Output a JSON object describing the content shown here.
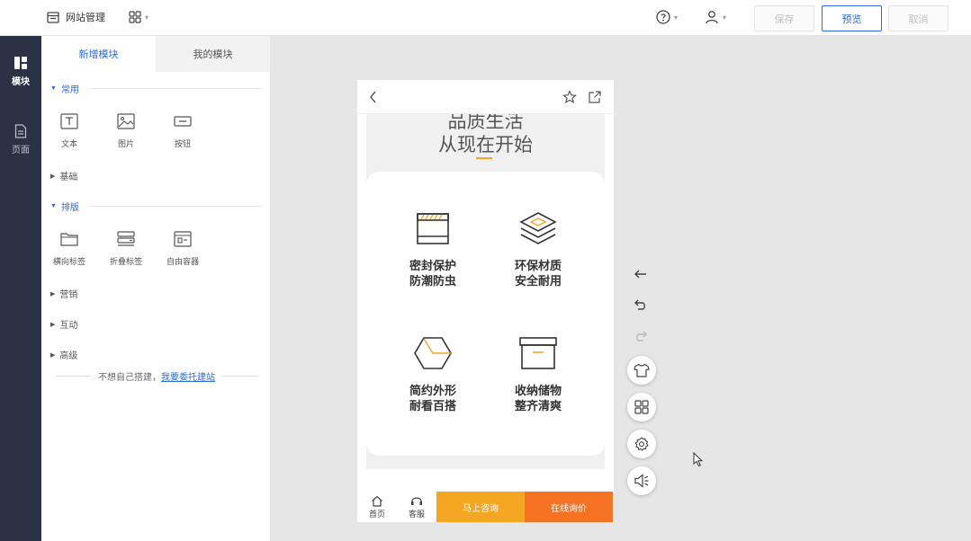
{
  "topbar": {
    "site_management": "网站管理",
    "save": "保存",
    "preview": "预览",
    "cancel": "取消"
  },
  "leftnav": {
    "modules": "模块",
    "pages": "页面"
  },
  "panel": {
    "tabs": [
      "新增模块",
      "我的模块"
    ],
    "sections": {
      "common": "常用",
      "basic": "基础",
      "layout": "排版",
      "marketing": "营销",
      "interaction": "互动",
      "advanced": "高级"
    },
    "common_modules": [
      "文本",
      "图片",
      "按钮"
    ],
    "layout_modules": [
      "横向标签",
      "折叠标签",
      "自由容器"
    ],
    "delegate_text": "不想自己搭建，",
    "delegate_link": "我要委托建站"
  },
  "phone": {
    "headline_1": "品质生活",
    "headline_2": "从现在开始",
    "features": [
      {
        "line1": "密封保护",
        "line2": "防潮防虫",
        "icon": "box-sealed-icon"
      },
      {
        "line1": "环保材质",
        "line2": "安全耐用",
        "icon": "layers-icon"
      },
      {
        "line1": "简约外形",
        "line2": "耐看百搭",
        "icon": "hexagon-icon"
      },
      {
        "line1": "收纳储物",
        "line2": "整齐清爽",
        "icon": "storage-box-icon"
      }
    ],
    "bottom": {
      "home": "首页",
      "service": "客服",
      "consult": "马上咨询",
      "inquire": "在线询价"
    }
  },
  "colors": {
    "accent_blue": "#2f6bd6",
    "nav_bg": "#2b3245",
    "orange": "#f5a623",
    "orange_dark": "#f57223"
  }
}
